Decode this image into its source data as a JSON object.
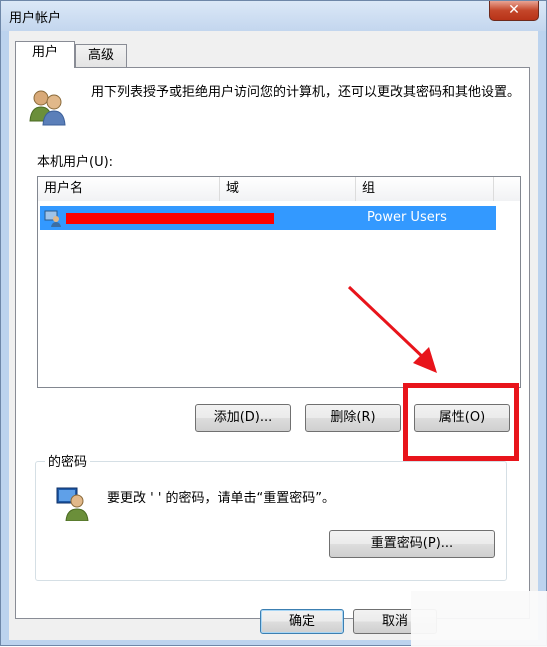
{
  "window": {
    "title": "用户帐户",
    "close_label": "✕"
  },
  "tabs": [
    {
      "label": "用户",
      "active": true
    },
    {
      "label": "高级",
      "active": false
    }
  ],
  "description": "用下列表授予或拒绝用户访问您的计算机，还可以更改其密码和其他设置。",
  "local_users_label": "本机用户(U):",
  "table": {
    "headers": [
      "用户名",
      "域",
      "组"
    ],
    "rows": [
      {
        "username": "[redacted]",
        "domain": "",
        "group": "Power Users",
        "selected": true
      }
    ]
  },
  "buttons": {
    "add": "添加(D)...",
    "remove": "删除(R)",
    "properties": "属性(O)",
    "reset_password": "重置密码(P)...",
    "ok": "确定",
    "cancel": "取消"
  },
  "password_group": {
    "title": "的密码",
    "text": "要更改 '  ' 的密码，请单击“重置密码”。"
  },
  "colors": {
    "highlight_box": "#e8141b",
    "arrow": "#e8141b",
    "selection": "#3399ff",
    "redaction": "#ff0000"
  }
}
